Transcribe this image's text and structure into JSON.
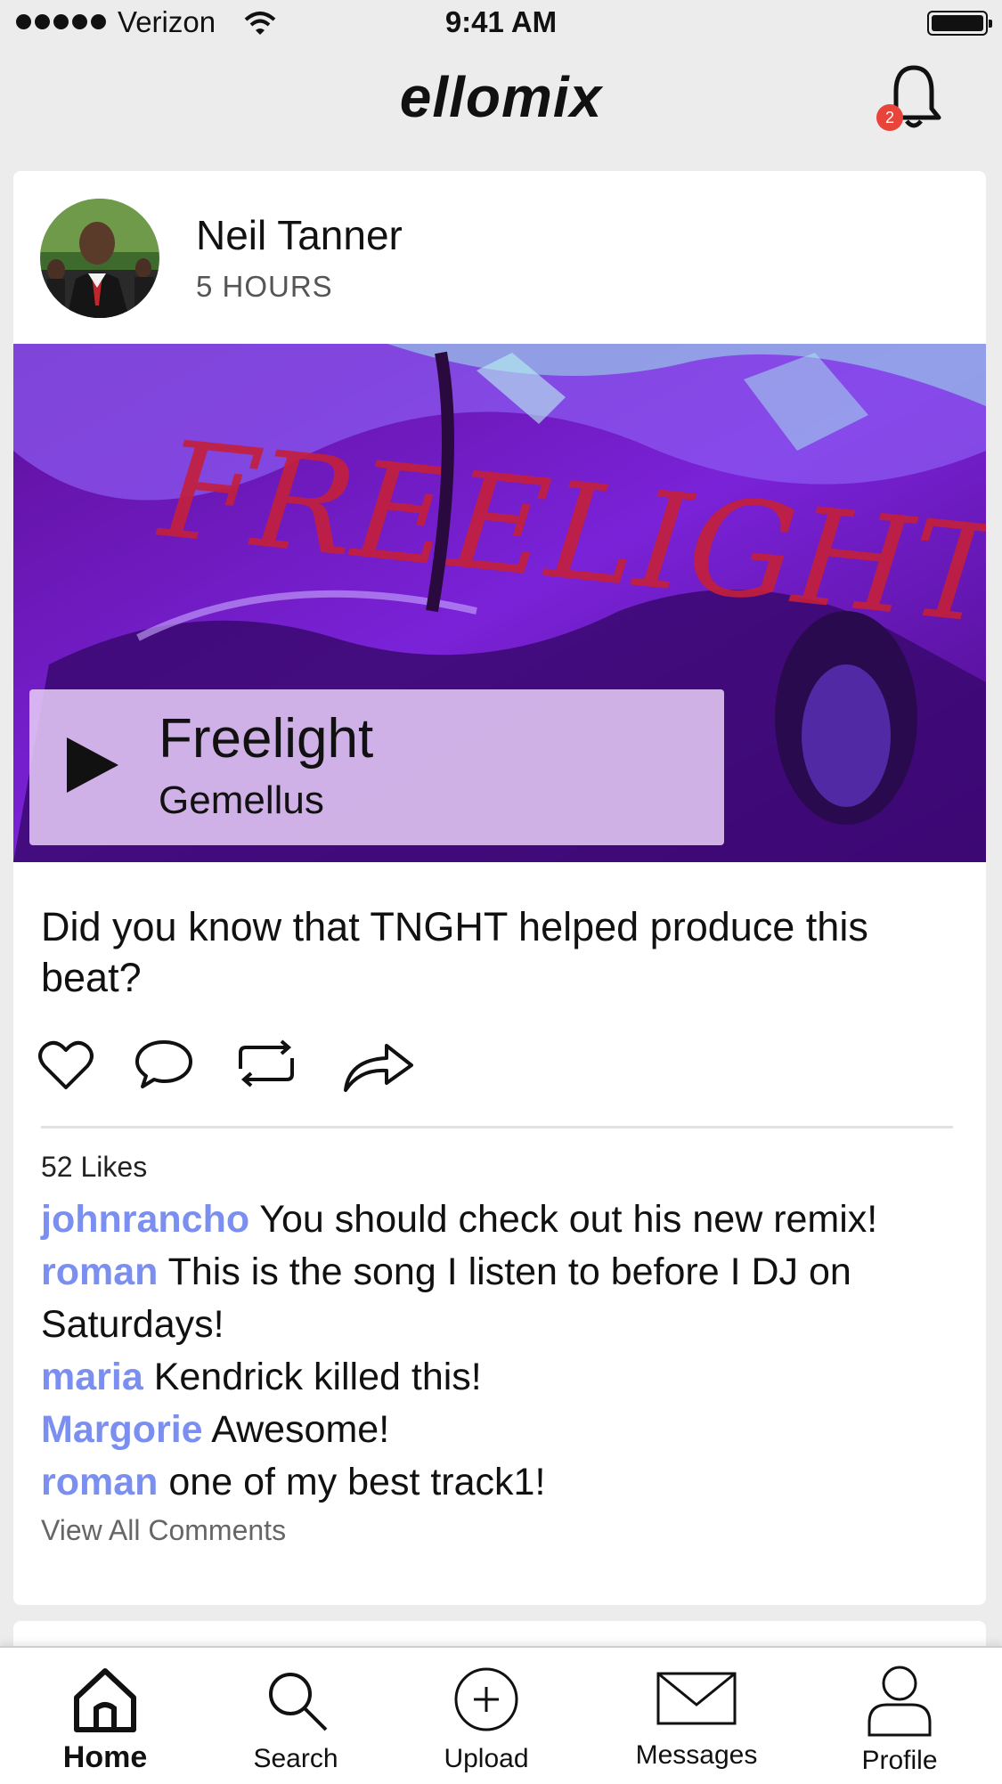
{
  "status_bar": {
    "carrier": "Verizon",
    "time": "9:41 AM"
  },
  "header": {
    "logo": "ellomix",
    "notification_count": "2"
  },
  "post": {
    "author": "Neil Tanner",
    "time_ago": "5 HOURS",
    "track": {
      "title": "Freelight",
      "artist": "Gemellus"
    },
    "caption": "Did you know that TNGHT helped produce this beat?",
    "likes": "52 Likes",
    "comments": [
      {
        "user": "johnrancho",
        "text": "You should check out his new remix!"
      },
      {
        "user": "roman",
        "text": "This is the song I listen to before I DJ on Saturdays!"
      },
      {
        "user": "maria",
        "text": "Kendrick killed this!"
      },
      {
        "user": "Margorie",
        "text": "Awesome!"
      },
      {
        "user": "roman",
        "text": "one of my best track1!"
      }
    ],
    "view_all": "View All Comments"
  },
  "tabs": [
    {
      "label": "Home",
      "icon": "home-icon",
      "active": true
    },
    {
      "label": "Search",
      "icon": "search-icon"
    },
    {
      "label": "Upload",
      "icon": "upload-icon"
    },
    {
      "label": "Messages",
      "icon": "envelope-icon"
    },
    {
      "label": "Profile",
      "icon": "person-icon"
    }
  ],
  "colors": {
    "accent_username": "#7b8ff0",
    "badge": "#e8443a",
    "background": "#ececec"
  }
}
